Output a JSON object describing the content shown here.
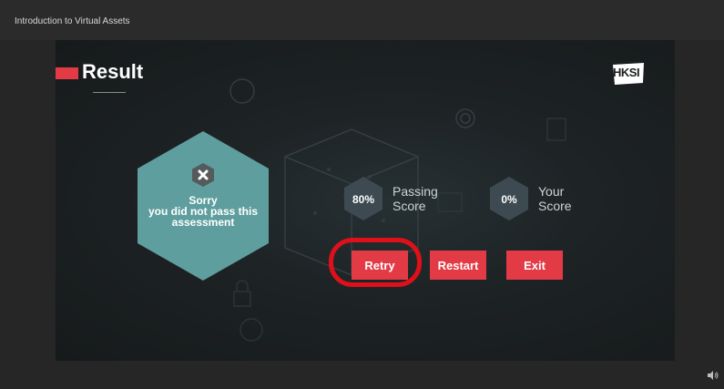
{
  "window": {
    "title": "Introduction to Virtual Assets"
  },
  "slide": {
    "title": "Result",
    "logo_text": "HKSI",
    "fail_icon": "close-icon",
    "fail_message": [
      "Sorry",
      "you did not pass this",
      "assessment"
    ],
    "passing": {
      "value": "80%",
      "label": [
        "Passing",
        "Score"
      ]
    },
    "yours": {
      "value": "0%",
      "label": [
        "Your",
        "Score"
      ]
    },
    "buttons": {
      "retry": "Retry",
      "restart": "Restart",
      "exit": "Exit"
    }
  },
  "colors": {
    "accent": "#e23b46",
    "fail_hex": "#5f9e9e",
    "score_hex": "#3d4a52",
    "highlight": "#e0101a"
  },
  "player": {
    "volume_icon": "volume-icon"
  }
}
